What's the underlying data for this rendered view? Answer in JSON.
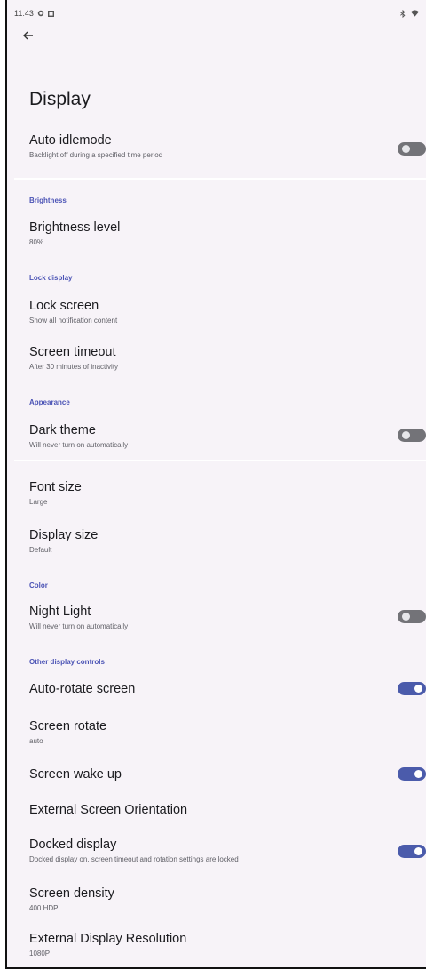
{
  "status_bar": {
    "time": "11:43",
    "left_icons": [
      "settings-icon",
      "notification-icon"
    ],
    "right_icons": [
      "bluetooth-icon",
      "wifi-icon"
    ]
  },
  "page": {
    "title": "Display"
  },
  "auto_idle": {
    "label": "Auto idlemode",
    "sub": "Backlight off during a specified time period",
    "toggle": false
  },
  "sections": {
    "brightness": "Brightness",
    "lock": "Lock display",
    "appearance": "Appearance",
    "color": "Color",
    "other": "Other display controls"
  },
  "brightness_level": {
    "label": "Brightness level",
    "sub": "80%"
  },
  "lock_screen": {
    "label": "Lock screen",
    "sub": "Show all notification content"
  },
  "screen_timeout": {
    "label": "Screen timeout",
    "sub": "After 30 minutes of inactivity"
  },
  "dark_theme": {
    "label": "Dark theme",
    "sub": "Will never turn on automatically",
    "toggle": false
  },
  "font_size": {
    "label": "Font size",
    "sub": "Large"
  },
  "display_size": {
    "label": "Display size",
    "sub": "Default"
  },
  "night_light": {
    "label": "Night Light",
    "sub": "Will never turn on automatically",
    "toggle": false
  },
  "auto_rotate": {
    "label": "Auto-rotate screen",
    "toggle": true
  },
  "screen_rotate": {
    "label": "Screen rotate",
    "sub": "auto"
  },
  "screen_wake": {
    "label": "Screen wake up",
    "toggle": true
  },
  "ext_orientation": {
    "label": "External Screen Orientation"
  },
  "docked_display": {
    "label": "Docked display",
    "sub": "Docked display on, screen timeout and rotation settings are locked",
    "toggle": true
  },
  "screen_density": {
    "label": "Screen density",
    "sub": "400 HDPI"
  },
  "ext_resolution": {
    "label": "External Display Resolution",
    "sub": "1080P"
  },
  "colors": {
    "accent": "#4b5bab",
    "section_text": "#4b53b5",
    "background": "#f7f3f8"
  }
}
